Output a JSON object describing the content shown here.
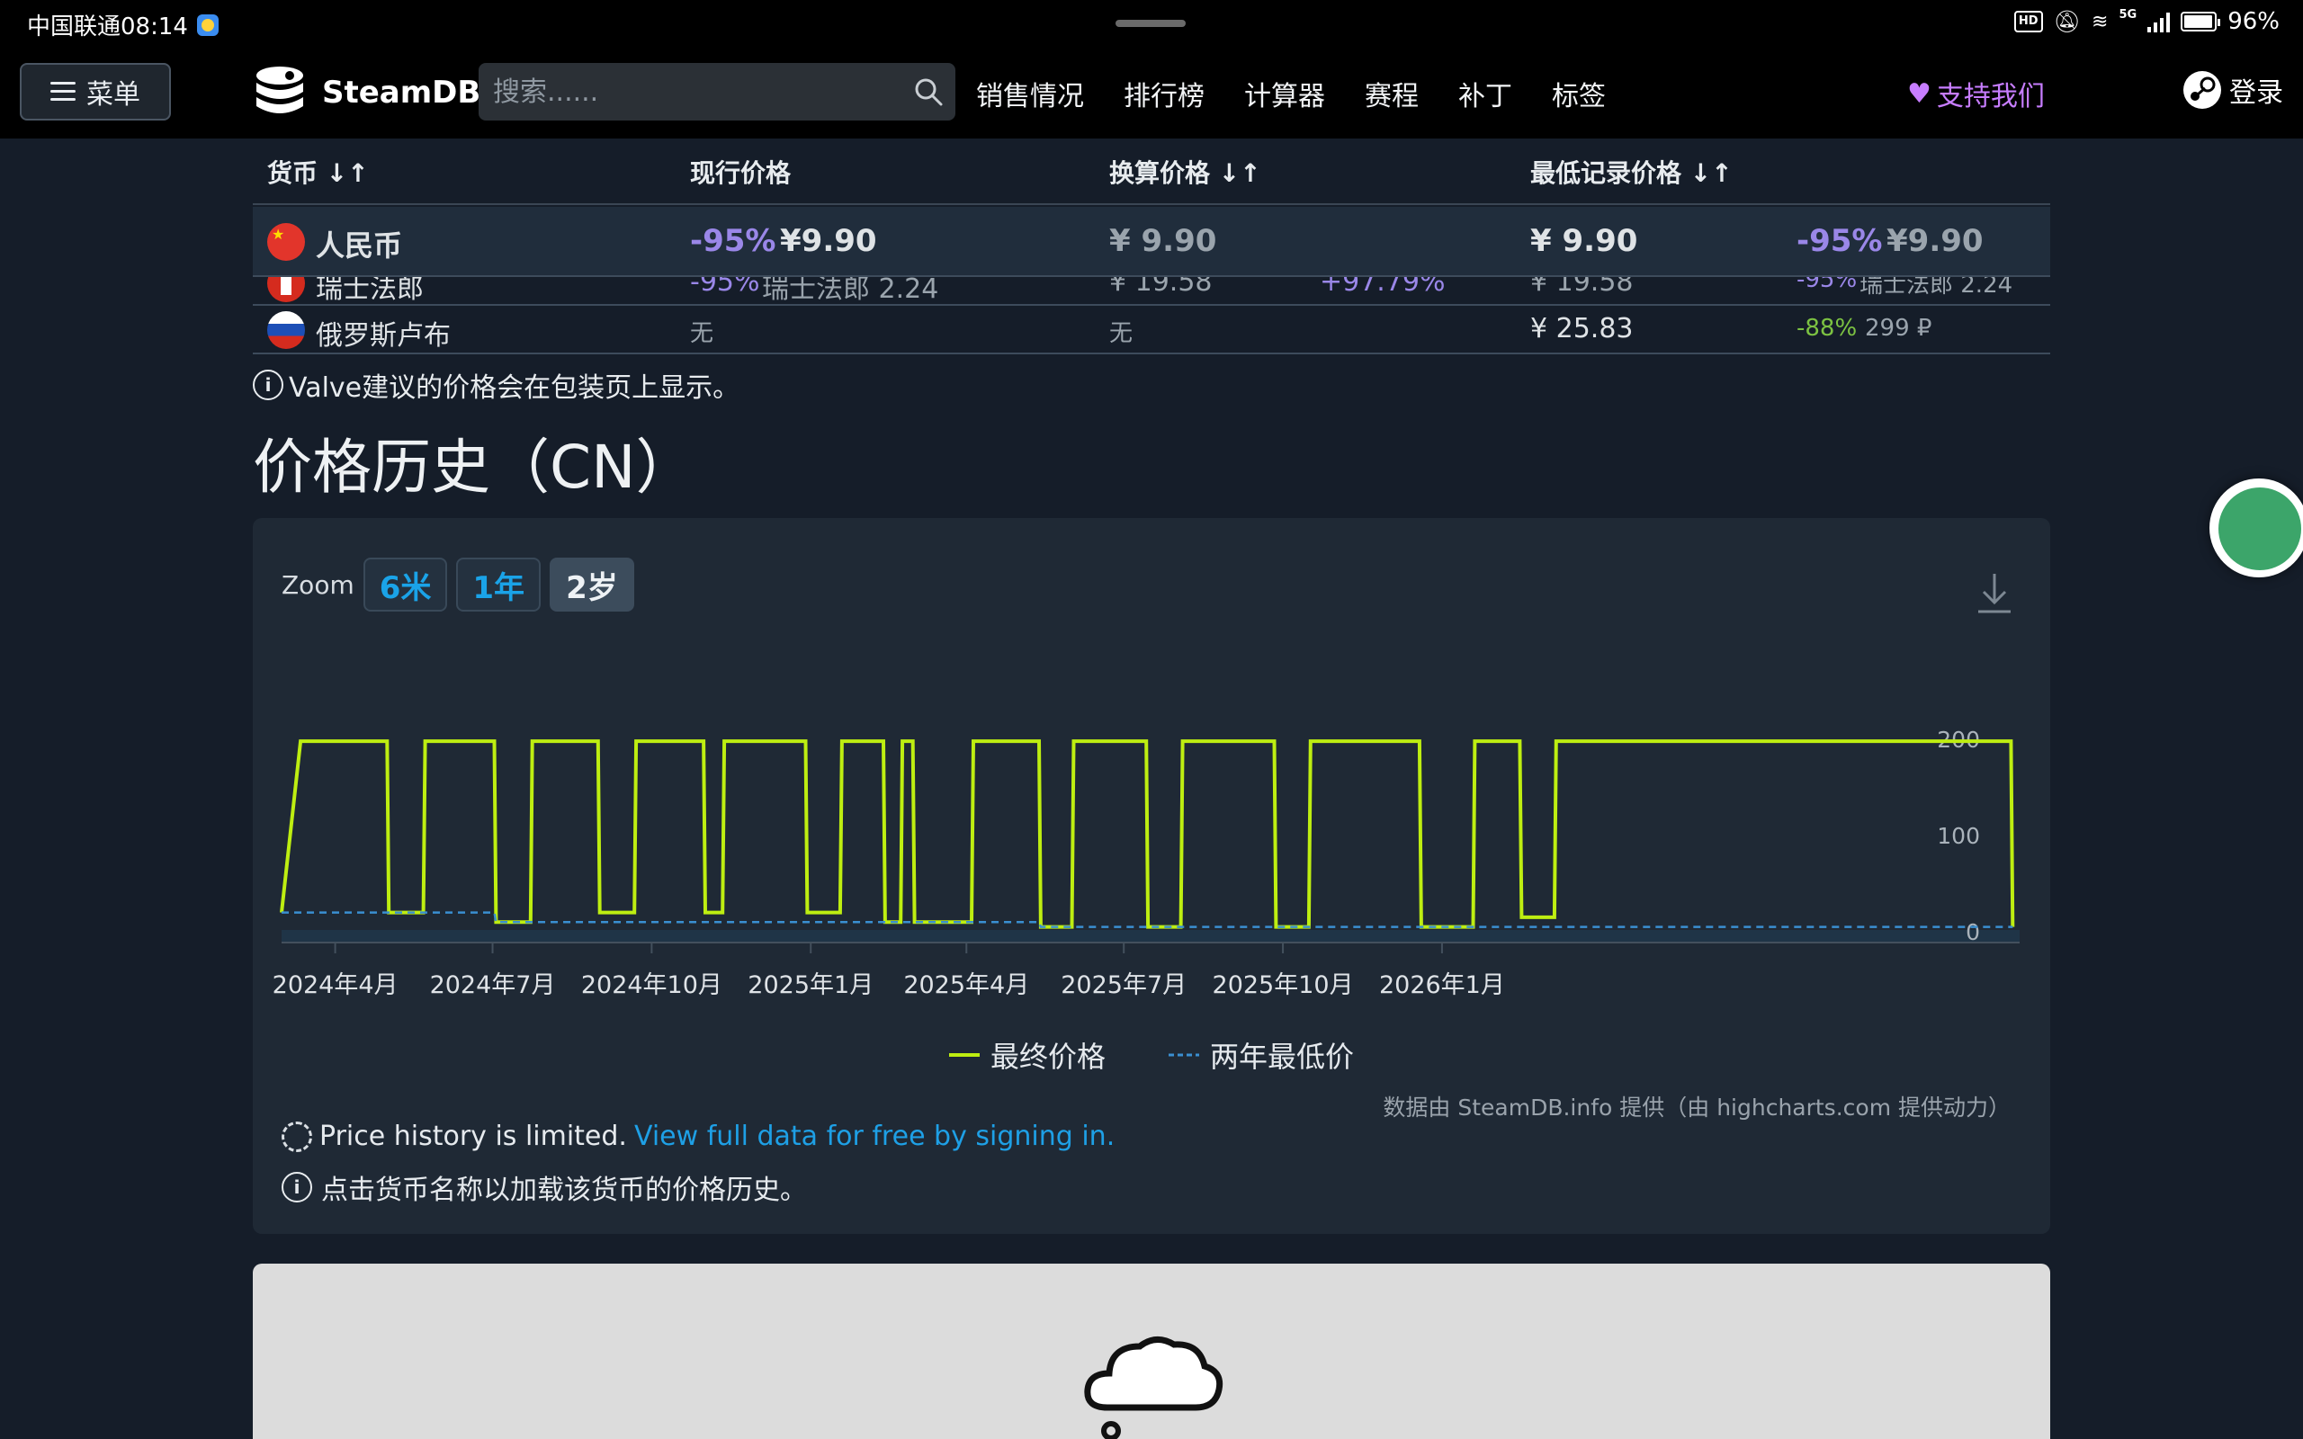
{
  "status_bar": {
    "carrier_time": "中国联通08:14",
    "network": "5G",
    "battery": "96%"
  },
  "nav": {
    "menu_label": "菜单",
    "brand": "SteamDB",
    "search_placeholder": "搜索......",
    "links": [
      "销售情况",
      "排行榜",
      "计算器",
      "赛程",
      "补丁",
      "标签"
    ],
    "support": "支持我们",
    "login": "登录"
  },
  "price_table": {
    "headers": {
      "currency": "货币 ↓↑",
      "current": "现行价格",
      "converted": "换算价格 ↓↑",
      "lowest": "最低记录价格 ↓↑"
    },
    "rows": [
      {
        "currency": "人民币",
        "discount": "-95%",
        "current": "¥9.90",
        "converted": "¥ 9.90",
        "diff": "",
        "lowest": "¥ 9.90",
        "lowest_discount": "-95%",
        "lowest_price": "¥9.90"
      },
      {
        "currency": "瑞士法郎",
        "discount": "-95%",
        "current": "瑞士法郎 2.24",
        "converted": "¥ 19.58",
        "diff": "+97.79%",
        "lowest": "¥ 19.58",
        "lowest_discount": "-95%",
        "lowest_price": "瑞士法郎 2.24"
      },
      {
        "currency": "俄罗斯卢布",
        "current": "无",
        "converted": "无",
        "lowest": "¥ 25.83",
        "lowest_discount": "-88%",
        "lowest_price": "299 ₽"
      }
    ]
  },
  "note": "Valve建议的价格会在包装页上显示。",
  "section_title": "价格历史（CN）",
  "chart_panel": {
    "zoom_label": "Zoom",
    "zoom_buttons": [
      "6米",
      "1年",
      "2岁"
    ],
    "active_zoom": "2岁",
    "credit": "数据由 SteamDB.info 提供（由 highcharts.com 提供动力）",
    "limited_text": "Price history is limited.",
    "limited_link": "View full data for free by signing in.",
    "click_note": "点击货币名称以加载该货币的价格历史。"
  },
  "chart_data": {
    "type": "line",
    "step": true,
    "x_ticks": [
      "2024年4月",
      "2024年7月",
      "2024年10月",
      "2025年1月",
      "2025年4月",
      "2025年7月",
      "2025年10月",
      "2026年1月"
    ],
    "y_ticks": [
      "0",
      "100",
      "200"
    ],
    "ylim": [
      0,
      200
    ],
    "series": [
      {
        "name": "最终价格",
        "color": "#beee11",
        "points": [
          [
            "2024-03-01",
            20
          ],
          [
            "2024-03-12",
            198
          ],
          [
            "2024-05-01",
            198
          ],
          [
            "2024-05-02",
            20
          ],
          [
            "2024-05-22",
            20
          ],
          [
            "2024-05-23",
            198
          ],
          [
            "2024-07-02",
            198
          ],
          [
            "2024-07-03",
            10
          ],
          [
            "2024-07-23",
            10
          ],
          [
            "2024-07-24",
            198
          ],
          [
            "2024-08-31",
            198
          ],
          [
            "2024-09-01",
            20
          ],
          [
            "2024-09-21",
            20
          ],
          [
            "2024-09-22",
            198
          ],
          [
            "2024-10-31",
            198
          ],
          [
            "2024-11-01",
            20
          ],
          [
            "2024-11-11",
            20
          ],
          [
            "2024-11-12",
            198
          ],
          [
            "2024-12-29",
            198
          ],
          [
            "2024-12-30",
            20
          ],
          [
            "2025-01-18",
            20
          ],
          [
            "2025-01-19",
            198
          ],
          [
            "2025-02-12",
            198
          ],
          [
            "2025-02-13",
            10
          ],
          [
            "2025-02-22",
            10
          ],
          [
            "2025-02-23",
            198
          ],
          [
            "2025-03-01",
            198
          ],
          [
            "2025-03-02",
            10
          ],
          [
            "2025-04-04",
            10
          ],
          [
            "2025-04-05",
            198
          ],
          [
            "2025-05-13",
            198
          ],
          [
            "2025-05-14",
            5
          ],
          [
            "2025-06-01",
            5
          ],
          [
            "2025-06-02",
            198
          ],
          [
            "2025-07-14",
            198
          ],
          [
            "2025-07-15",
            5
          ],
          [
            "2025-08-03",
            5
          ],
          [
            "2025-08-04",
            198
          ],
          [
            "2025-09-26",
            198
          ],
          [
            "2025-09-27",
            5
          ],
          [
            "2025-10-16",
            5
          ],
          [
            "2025-10-17",
            198
          ],
          [
            "2025-12-19",
            198
          ],
          [
            "2025-12-20",
            5
          ],
          [
            "2026-01-19",
            5
          ],
          [
            "2026-01-20",
            198
          ],
          [
            "2026-02-15",
            198
          ],
          [
            "2026-02-16",
            15
          ],
          [
            "2026-03-07",
            15
          ],
          [
            "2026-03-08",
            198
          ],
          [
            "2026-11-26",
            198
          ],
          [
            "2026-11-27",
            5
          ]
        ]
      },
      {
        "name": "两年最低价",
        "color": "#3a8fd1",
        "dashed": true,
        "points": [
          [
            "2024-03-01",
            20
          ],
          [
            "2024-07-02",
            20
          ],
          [
            "2024-07-03",
            10
          ],
          [
            "2025-05-13",
            10
          ],
          [
            "2025-05-14",
            5
          ],
          [
            "2026-11-27",
            5
          ]
        ]
      }
    ]
  }
}
